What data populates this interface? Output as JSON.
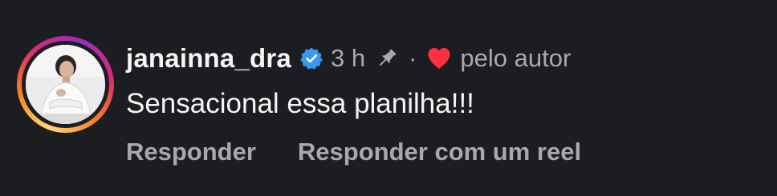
{
  "comment": {
    "username": "janainna_dra",
    "verified": true,
    "time": "3 h",
    "separator": "·",
    "liked_by_author_label": "pelo autor",
    "text": "Sensacional essa planilha!!!",
    "actions": {
      "reply": "Responder",
      "reply_with_reel": "Responder com um reel"
    },
    "icons": {
      "verified": "verified-badge-icon",
      "pin": "pin-icon",
      "heart": "heart-icon"
    },
    "colors": {
      "background": "#1c1d21",
      "verified": "#3897f0",
      "heart": "#ff3040",
      "muted_text": "#a8a8ad"
    }
  }
}
